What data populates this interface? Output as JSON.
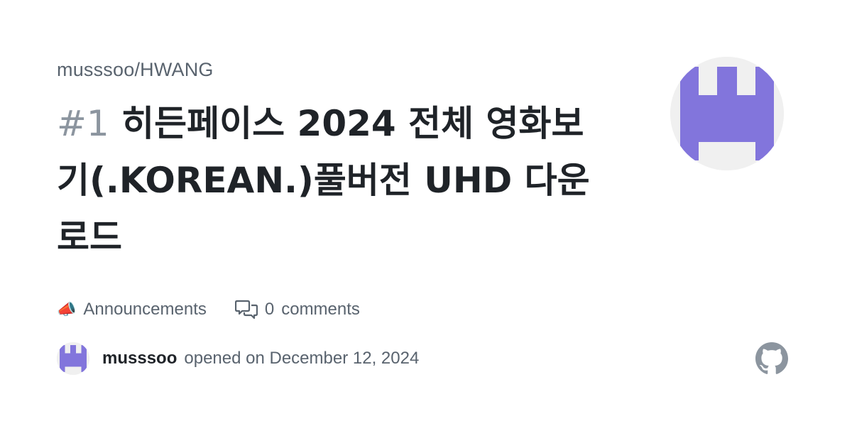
{
  "repository": "musssoo/HWANG",
  "issue": {
    "number": "#1",
    "title": "히든페이스 2024 전체 영화보기(.KOREAN.)풀버전 UHD 다운로드"
  },
  "category": {
    "emoji": "📣",
    "label": "Announcements"
  },
  "comments": {
    "count": "0",
    "label": "comments"
  },
  "author": {
    "name": "musssoo",
    "opened_text": "opened on December 12, 2024"
  },
  "avatar": {
    "primary_color": "#8275dc",
    "background_color": "#f0f0f0"
  },
  "icons": {
    "comments": "comment-discussion-icon",
    "github": "github-mark-icon"
  },
  "colors": {
    "text": "#1f2328",
    "muted": "#59636e",
    "issue_number": "#8c959f",
    "github_mark": "#8c959f"
  }
}
